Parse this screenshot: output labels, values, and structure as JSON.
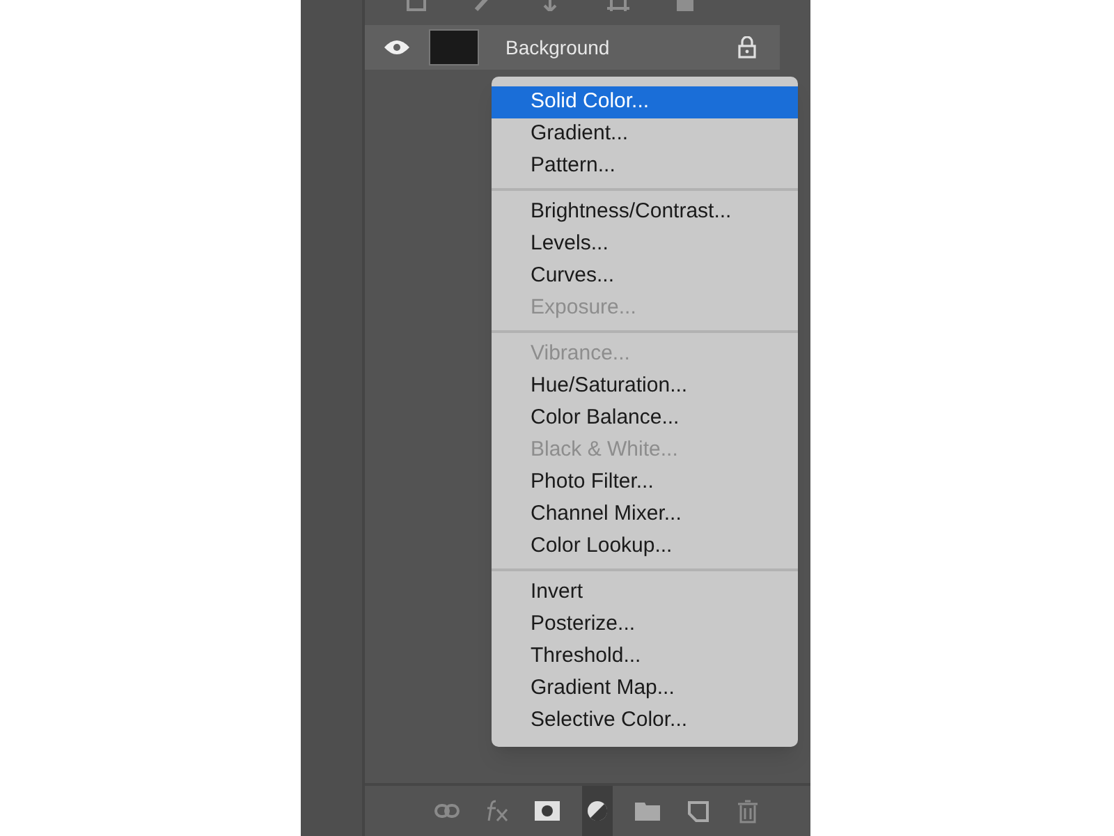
{
  "layer": {
    "name": "Background",
    "visible": true,
    "locked": true
  },
  "menu": {
    "sections": [
      {
        "items": [
          {
            "label": "Solid Color...",
            "selected": true,
            "disabled": false
          },
          {
            "label": "Gradient...",
            "selected": false,
            "disabled": false
          },
          {
            "label": "Pattern...",
            "selected": false,
            "disabled": false
          }
        ]
      },
      {
        "items": [
          {
            "label": "Brightness/Contrast...",
            "selected": false,
            "disabled": false
          },
          {
            "label": "Levels...",
            "selected": false,
            "disabled": false
          },
          {
            "label": "Curves...",
            "selected": false,
            "disabled": false
          },
          {
            "label": "Exposure...",
            "selected": false,
            "disabled": true
          }
        ]
      },
      {
        "items": [
          {
            "label": "Vibrance...",
            "selected": false,
            "disabled": true
          },
          {
            "label": "Hue/Saturation...",
            "selected": false,
            "disabled": false
          },
          {
            "label": "Color Balance...",
            "selected": false,
            "disabled": false
          },
          {
            "label": "Black & White...",
            "selected": false,
            "disabled": true
          },
          {
            "label": "Photo Filter...",
            "selected": false,
            "disabled": false
          },
          {
            "label": "Channel Mixer...",
            "selected": false,
            "disabled": false
          },
          {
            "label": "Color Lookup...",
            "selected": false,
            "disabled": false
          }
        ]
      },
      {
        "items": [
          {
            "label": "Invert",
            "selected": false,
            "disabled": false
          },
          {
            "label": "Posterize...",
            "selected": false,
            "disabled": false
          },
          {
            "label": "Threshold...",
            "selected": false,
            "disabled": false
          },
          {
            "label": "Gradient Map...",
            "selected": false,
            "disabled": false
          },
          {
            "label": "Selective Color...",
            "selected": false,
            "disabled": false
          }
        ]
      }
    ]
  },
  "toolbar": [
    {
      "kind": "link",
      "selected": false
    },
    {
      "kind": "fx",
      "selected": false
    },
    {
      "kind": "mask",
      "selected": false
    },
    {
      "kind": "adjustment",
      "selected": true
    },
    {
      "kind": "folder",
      "selected": false
    },
    {
      "kind": "new",
      "selected": false
    },
    {
      "kind": "trash",
      "selected": false
    }
  ]
}
